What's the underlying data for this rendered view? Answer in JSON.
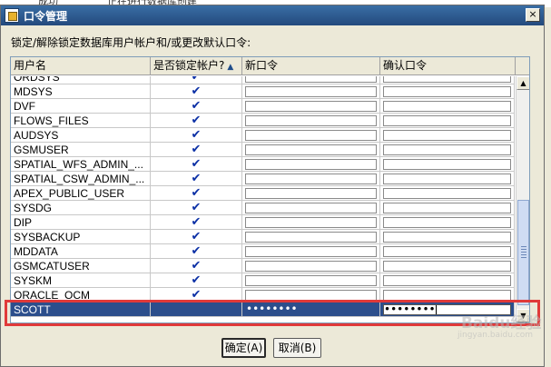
{
  "background": {
    "fragment_left": "成功",
    "fragment_right": "正在进行数据库创建"
  },
  "dialog": {
    "title": "口令管理",
    "close_icon": "×",
    "instruction": "锁定/解除锁定数据库用户帐户和/或更改默认口令:",
    "columns": {
      "user": "用户名",
      "locked": "是否锁定帐户?",
      "sort_indicator": "▲",
      "new_password": "新口令",
      "confirm_password": "确认口令"
    },
    "check_glyph": "✔",
    "rows": [
      {
        "user": "ORDSYS",
        "locked": true,
        "new_password": "",
        "confirm_password": ""
      },
      {
        "user": "MDSYS",
        "locked": true,
        "new_password": "",
        "confirm_password": ""
      },
      {
        "user": "DVF",
        "locked": true,
        "new_password": "",
        "confirm_password": ""
      },
      {
        "user": "FLOWS_FILES",
        "locked": true,
        "new_password": "",
        "confirm_password": ""
      },
      {
        "user": "AUDSYS",
        "locked": true,
        "new_password": "",
        "confirm_password": ""
      },
      {
        "user": "GSMUSER",
        "locked": true,
        "new_password": "",
        "confirm_password": ""
      },
      {
        "user": "SPATIAL_WFS_ADMIN_...",
        "locked": true,
        "new_password": "",
        "confirm_password": ""
      },
      {
        "user": "SPATIAL_CSW_ADMIN_...",
        "locked": true,
        "new_password": "",
        "confirm_password": ""
      },
      {
        "user": "APEX_PUBLIC_USER",
        "locked": true,
        "new_password": "",
        "confirm_password": ""
      },
      {
        "user": "SYSDG",
        "locked": true,
        "new_password": "",
        "confirm_password": ""
      },
      {
        "user": "DIP",
        "locked": true,
        "new_password": "",
        "confirm_password": ""
      },
      {
        "user": "SYSBACKUP",
        "locked": true,
        "new_password": "",
        "confirm_password": ""
      },
      {
        "user": "MDDATA",
        "locked": true,
        "new_password": "",
        "confirm_password": ""
      },
      {
        "user": "GSMCATUSER",
        "locked": true,
        "new_password": "",
        "confirm_password": ""
      },
      {
        "user": "SYSKM",
        "locked": true,
        "new_password": "",
        "confirm_password": ""
      },
      {
        "user": "ORACLE_OCM",
        "locked": true,
        "new_password": "",
        "confirm_password": ""
      },
      {
        "user": "SCOTT",
        "locked": false,
        "selected": true,
        "new_password": "••••••••",
        "confirm_password": "••••••••"
      }
    ],
    "buttons": {
      "ok": "确定(A)",
      "cancel": "取消(B)"
    },
    "scroll_arrows": {
      "up": "▲",
      "down": "▼"
    }
  },
  "watermark": {
    "main": "Baidu经验",
    "sub": "jingyan.baidu.com"
  },
  "colors": {
    "titlebar": "#2f5f98",
    "selection": "#2c4e8c",
    "check": "#0b2fa5",
    "highlight_frame": "#e03a3a"
  },
  "icons": [
    "window-icon",
    "close-icon",
    "sort-ascending-icon",
    "checkmark-icon",
    "scroll-up-icon",
    "scroll-down-icon"
  ]
}
